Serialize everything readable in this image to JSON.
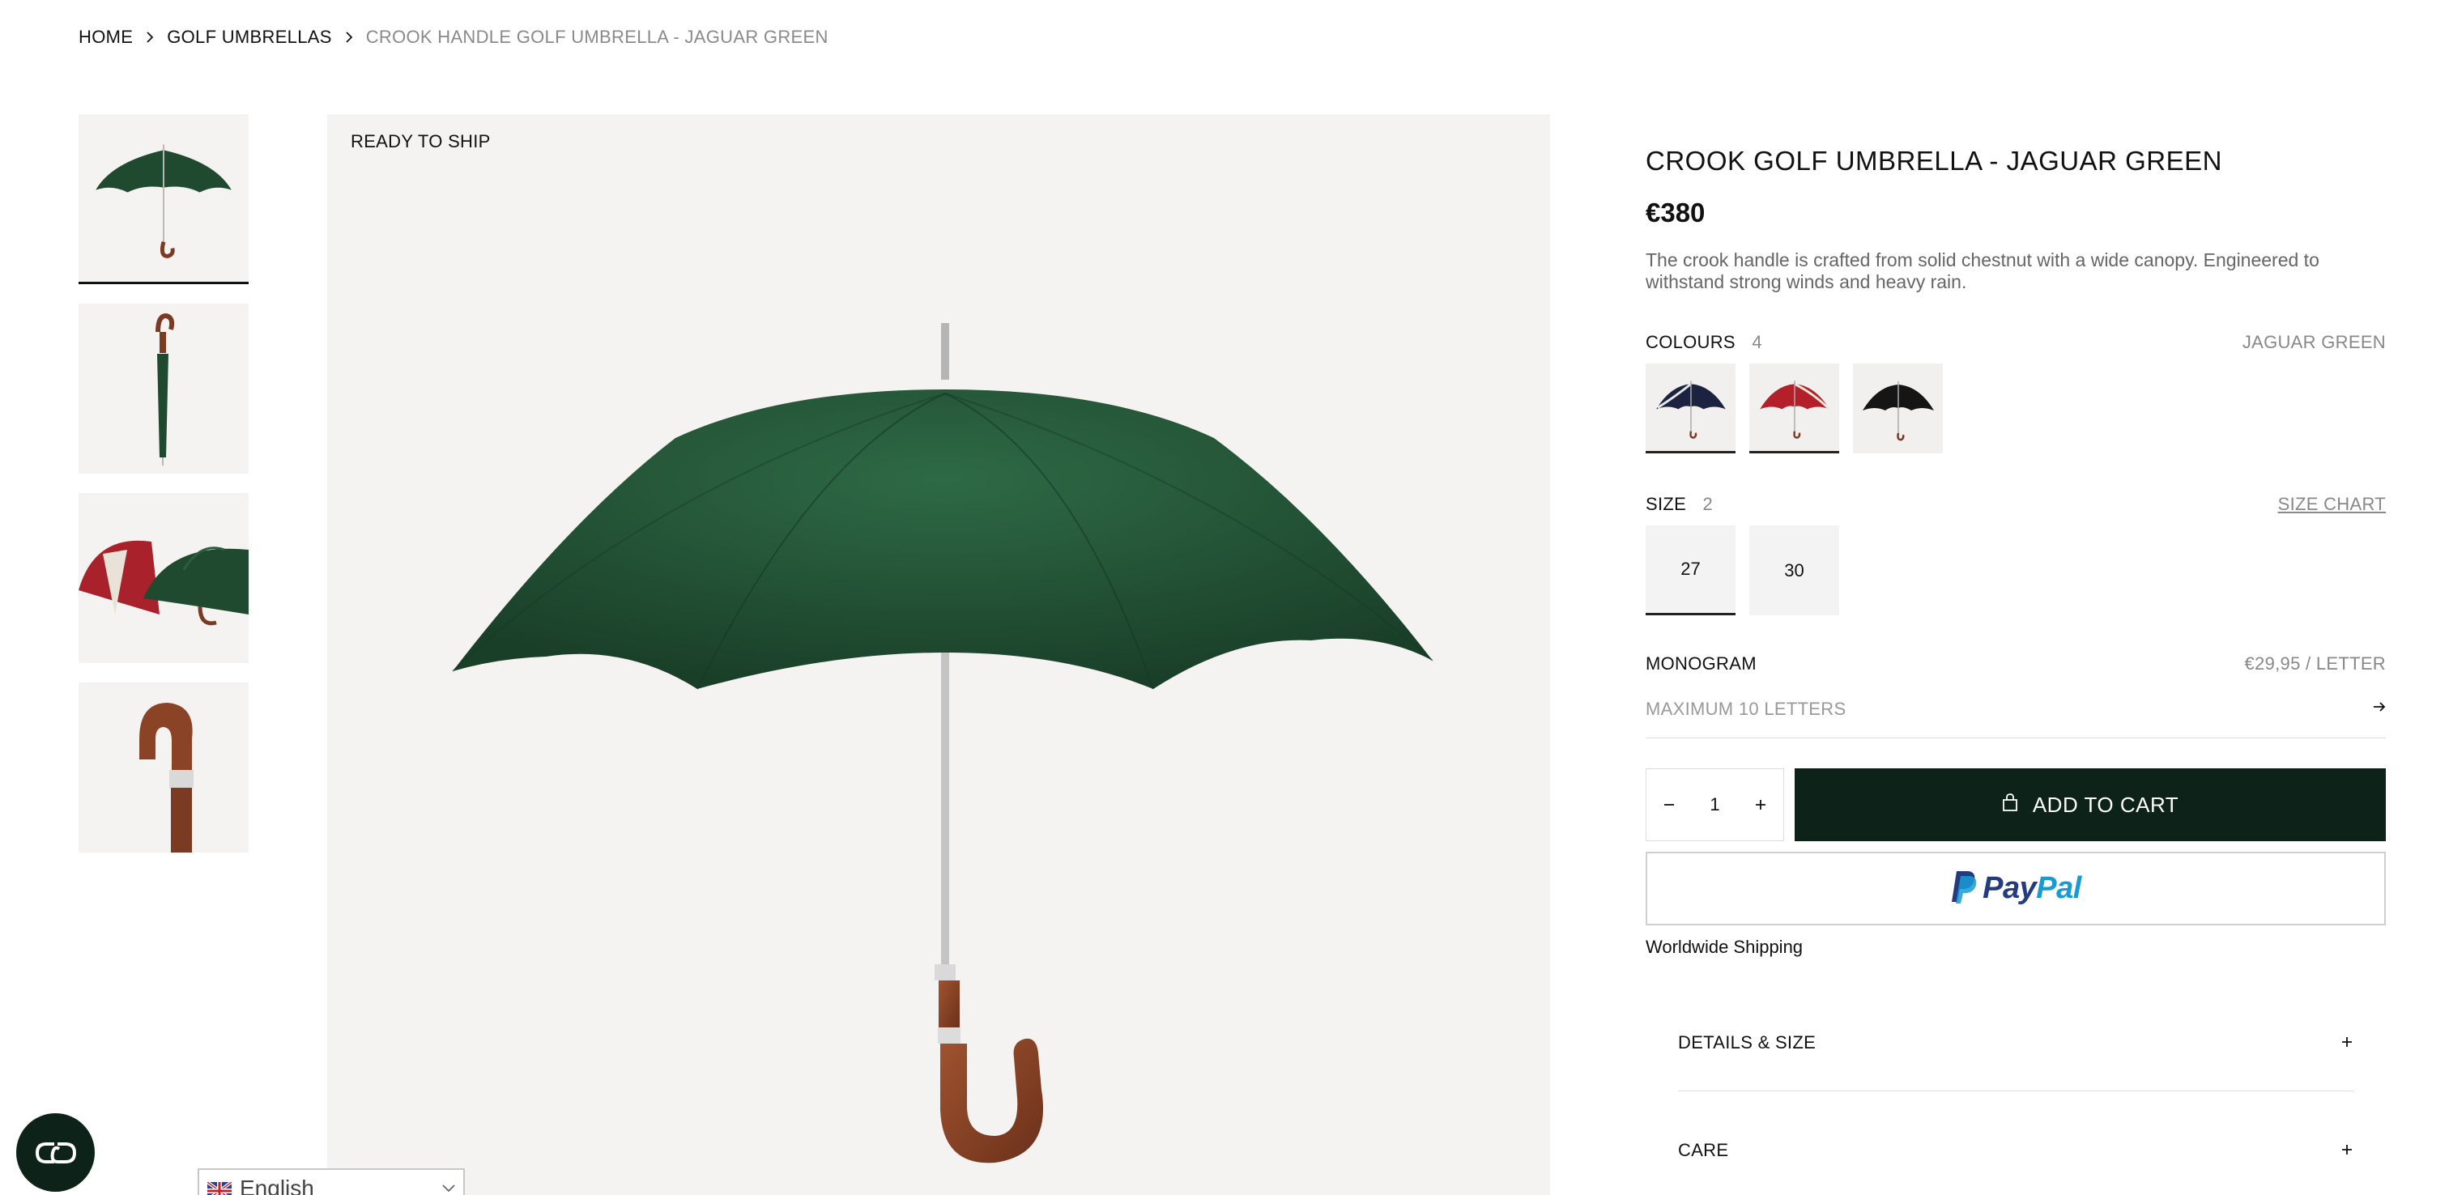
{
  "breadcrumb": {
    "items": [
      {
        "label": "HOME"
      },
      {
        "label": "GOLF UMBRELLAS"
      },
      {
        "label": "CROOK HANDLE GOLF UMBRELLA - JAGUAR GREEN"
      }
    ]
  },
  "gallery": {
    "badge": "READY TO SHIP",
    "thumbnails": [
      "open-umbrella-green",
      "closed-umbrella-green",
      "umbrellas-red-and-green",
      "chestnut-crook-handle"
    ],
    "active_index": 0
  },
  "product": {
    "title": "CROOK GOLF UMBRELLA - JAGUAR GREEN",
    "price": "€380",
    "description": "The crook handle is crafted from solid chestnut with a wide canopy. Engineered to withstand strong winds and heavy rain."
  },
  "colours": {
    "label": "COLOURS",
    "count": "4",
    "selected_name": "JAGUAR GREEN",
    "swatches": [
      {
        "name": "navy",
        "color": "#1c2340"
      },
      {
        "name": "red",
        "color": "#b3202a"
      },
      {
        "name": "black",
        "color": "#151515"
      }
    ]
  },
  "size": {
    "label": "SIZE",
    "count": "2",
    "chart_link": "SIZE CHART",
    "options": [
      "27",
      "30"
    ],
    "selected": "27"
  },
  "monogram": {
    "label": "MONOGRAM",
    "price": "€29,95 / LETTER",
    "placeholder": "MAXIMUM 10 LETTERS"
  },
  "cart": {
    "quantity": "1",
    "add_label": "ADD TO CART"
  },
  "paypal": {
    "pay": "Pay",
    "pal": "Pal"
  },
  "shipping_note": "Worldwide Shipping",
  "accordion": [
    {
      "label": "DETAILS & SIZE"
    },
    {
      "label": "CARE"
    }
  ],
  "language": {
    "selected": "English"
  },
  "colors": {
    "brand_dark": "#0d2218",
    "canopy_green": "#1f4a30",
    "image_bg": "#f5f3f1"
  }
}
